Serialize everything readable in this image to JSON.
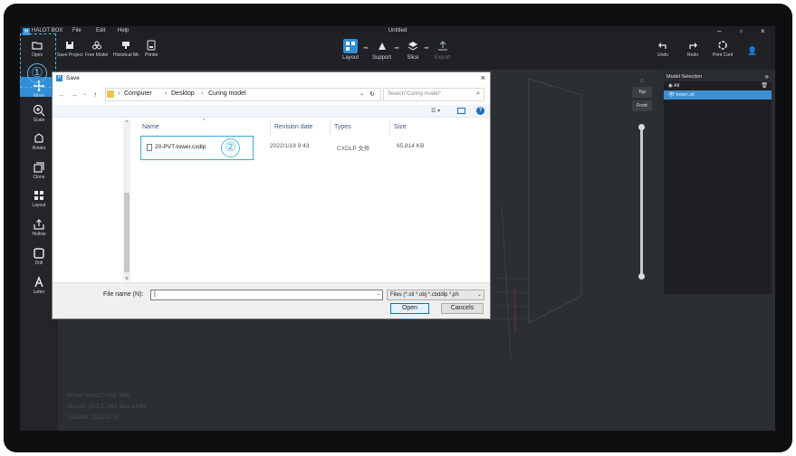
{
  "colors": {
    "accent": "#2f8ed8",
    "annotation": "#5fb3ea",
    "background": "#2a2d32"
  },
  "titlebar": {
    "app_name": "HALOT BOX",
    "menus": [
      "File",
      "Edit",
      "Help"
    ],
    "window_title": "Untitled",
    "controls": [
      "–",
      "▫",
      "×"
    ]
  },
  "toolbar": {
    "buttons": [
      "Open",
      "Save Project",
      "Free Model",
      "Historical Mc",
      "Printer"
    ],
    "modes": [
      "Layout",
      "Support",
      "Slice",
      "Export"
    ],
    "undo": "Undo",
    "redo": "Redo",
    "print_cont": "Print Cont"
  },
  "sidebar": {
    "items": [
      "Move",
      "Scale",
      "Rotate",
      "Clone",
      "Layout",
      "Hollow",
      "Drill",
      "Letter"
    ]
  },
  "annotations": {
    "step1": "①",
    "step2": "②"
  },
  "viewport": {
    "version_lines": [
      "Printer: HALOT-ONE PRO",
      "Version: V3.2.2.1691 Beta win64",
      "Updated: 2022-02-18"
    ],
    "view_cube": {
      "top": "Top",
      "front": "Front"
    }
  },
  "model_panel": {
    "title": "Model Selection",
    "all_label": "All",
    "models": [
      "tower.stl"
    ]
  },
  "dialog": {
    "title": "Save",
    "breadcrumb": [
      "Computer",
      "Desktop",
      "Curing model"
    ],
    "search_placeholder": "Search\"Curing model\"",
    "columns": {
      "name": "Name",
      "revision": "Revision date",
      "types": "Types",
      "size": "Size"
    },
    "file": {
      "name": "20-PVT-tower.cxdlp",
      "revision": "2022/1/18 9:43",
      "type": "CXDLP 文件",
      "size": "65,814 KB"
    },
    "file_name_label": "File name (N):",
    "file_name_value": "",
    "file_type": "Files (*.stl *.obj *.cbddlp *.ph",
    "open_button": "Open",
    "cancel_button": "Cancels"
  }
}
